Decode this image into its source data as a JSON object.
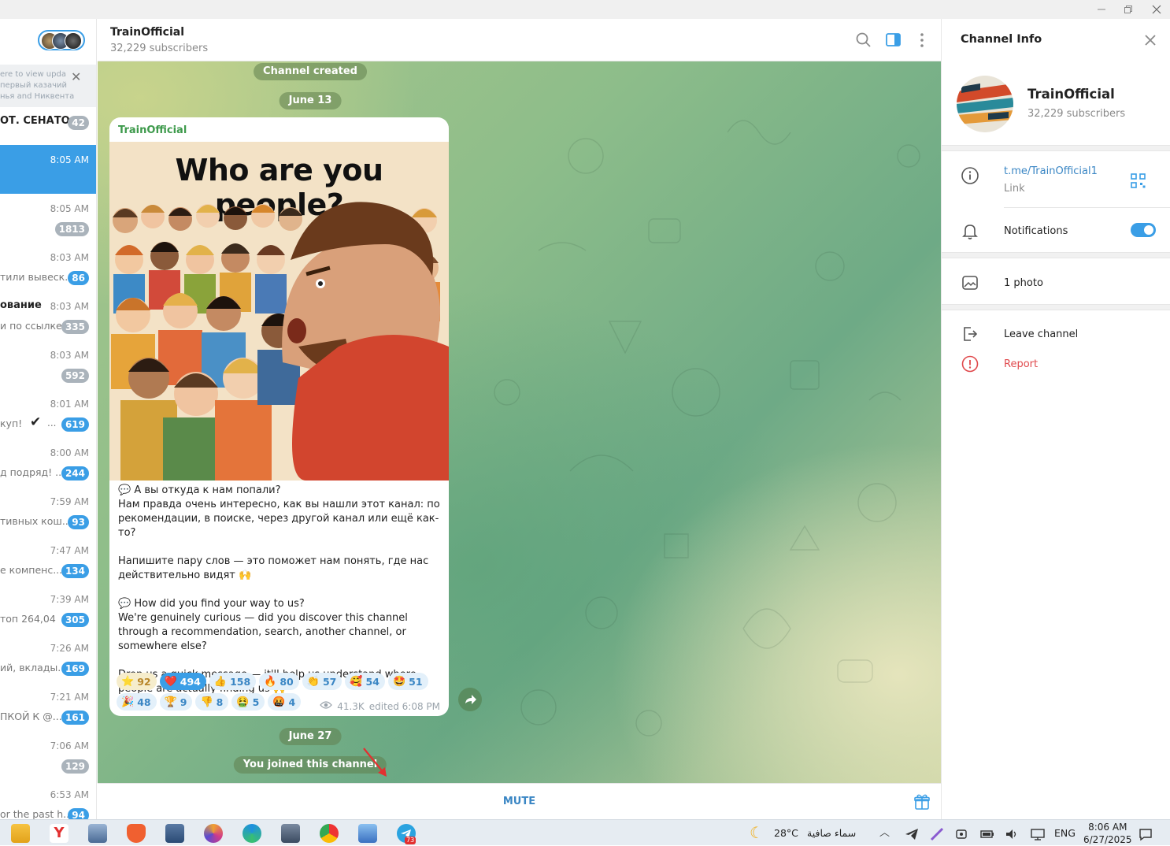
{
  "chat_list": {
    "banner_lines": [
      "ere to view upda",
      "первый казачий",
      "нья and Никвента"
    ],
    "pinned": {
      "name": "ОТ. СЕНАТО...",
      "count": "42"
    },
    "rows": [
      {
        "name": "",
        "msg": "",
        "time": "8:05 AM",
        "count": ""
      },
      {
        "name": "",
        "msg": "",
        "time": "8:05 AM",
        "count": "1813"
      },
      {
        "name": "",
        "msg": "тили вывеск...",
        "time": "8:03 AM",
        "count": "86"
      },
      {
        "name": "ование",
        "msg": "и по ссылке...",
        "time": "8:03 AM",
        "count": "335"
      },
      {
        "name": "",
        "msg": "",
        "time": "8:03 AM",
        "count": "592"
      },
      {
        "name": "",
        "msg": "куп!",
        "time": "8:01 AM",
        "count": "619"
      },
      {
        "name": "",
        "msg": "д подряд! ...",
        "time": "8:00 AM",
        "count": "244"
      },
      {
        "name": "",
        "msg": "тивных кош...",
        "time": "7:59 AM",
        "count": "93"
      },
      {
        "name": "",
        "msg": "е компенс...",
        "time": "7:47 AM",
        "count": "134"
      },
      {
        "name": "",
        "msg": "топ 264,04",
        "time": "7:39 AM",
        "count": "305"
      },
      {
        "name": "",
        "msg": "ий, вклады...",
        "time": "7:26 AM",
        "count": "169"
      },
      {
        "name": "",
        "msg": "ПКОЙ К @...",
        "time": "7:21 AM",
        "count": "161"
      },
      {
        "name": "",
        "msg": "",
        "time": "7:06 AM",
        "count": "129"
      },
      {
        "name": "",
        "msg": "or the past h...",
        "time": "6:53 AM",
        "count": "94"
      }
    ]
  },
  "chat": {
    "title": "TrainOfficial",
    "subscribers": "32,229 subscribers",
    "service": {
      "created": "Channel created",
      "date1": "June 13",
      "date2": "June 27",
      "joined": "You joined this channel"
    },
    "post": {
      "author": "TrainOfficial",
      "image_title": "Who are you people?",
      "text_ru_1": "💬 А вы откуда к нам попали?\nНам правда очень интересно, как вы нашли этот канал: по рекомендации, в поиске, через другой канал или ещё как-то?",
      "text_ru_2": "Напишите пару слов — это поможет нам понять, где нас действительно видят 🙌",
      "text_en_1": "💬 How did you find your way to us?\nWe're genuinely curious — did you discover this channel through a recommendation, search, another channel, or somewhere else?",
      "text_en_2": "Drop us a quick message — it'll help us understand where people are actually finding us 🙌",
      "reactions_row1": [
        {
          "emoji": "⭐",
          "count": "92",
          "on": false,
          "style": "gold"
        },
        {
          "emoji": "❤️",
          "count": "494",
          "on": true
        },
        {
          "emoji": "👍",
          "count": "158",
          "on": false
        },
        {
          "emoji": "🔥",
          "count": "80",
          "on": false
        },
        {
          "emoji": "👏",
          "count": "57",
          "on": false
        },
        {
          "emoji": "🥰",
          "count": "54",
          "on": false
        },
        {
          "emoji": "🤩",
          "count": "51",
          "on": false
        }
      ],
      "reactions_row2": [
        {
          "emoji": "🎉",
          "count": "48",
          "on": false
        },
        {
          "emoji": "🏆",
          "count": "9",
          "on": false
        },
        {
          "emoji": "👎",
          "count": "8",
          "on": false
        },
        {
          "emoji": "🤮",
          "count": "5",
          "on": false
        },
        {
          "emoji": "🤬",
          "count": "4",
          "on": false
        }
      ],
      "views": "41.3K",
      "edited": "edited 6:08 PM"
    },
    "footer": {
      "mute_label": "MUTE"
    }
  },
  "info_panel": {
    "title": "Channel Info",
    "name": "TrainOfficial",
    "subscribers": "32,229 subscribers",
    "link": "t.me/TrainOfficial1",
    "link_caption": "Link",
    "notifications": "Notifications",
    "notifications_on": true,
    "photos": "1 photo",
    "leave": "Leave channel",
    "report": "Report"
  },
  "taskbar": {
    "weather_temp": "28°C",
    "weather_text": "سماء صافية",
    "lang": "ENG",
    "time": "8:06 AM",
    "date": "6/27/2025",
    "telegram_badge": "73"
  },
  "colors": {
    "accent": "#3a9ee6",
    "link": "#3a86c4",
    "report": "#e0494c",
    "author": "#3e9a4c"
  }
}
